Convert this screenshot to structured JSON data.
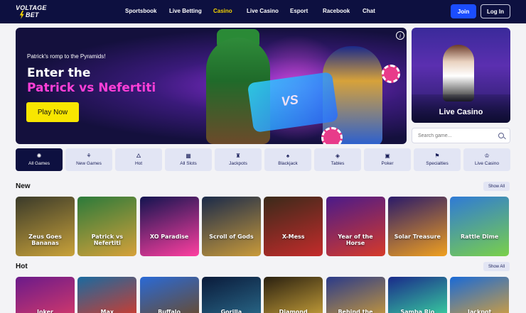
{
  "brand": {
    "logo_line1": "VOLTAGE",
    "logo_line2": "BET"
  },
  "nav": {
    "items": [
      "Sportsbook",
      "Live Betting",
      "Casino",
      "Live Casino",
      "Esport",
      "Racebook",
      "Chat"
    ],
    "active": "Casino",
    "join_label": "Join",
    "login_label": "Log In"
  },
  "hero": {
    "subtitle": "Patrick's romp to the Pyramids!",
    "headline": "Enter the",
    "game_title": "Patrick vs Nefertiti",
    "cta_label": "Play Now",
    "badge_text": "VS",
    "info_icon": "i",
    "slide_count": 3,
    "active_slide": 1
  },
  "live_casino_card": {
    "label": "Live Casino"
  },
  "search": {
    "placeholder": "Search game..."
  },
  "categories": [
    {
      "label": "All Games",
      "icon": "✺",
      "active": true
    },
    {
      "label": "New Games",
      "icon": "⚘"
    },
    {
      "label": "Hot",
      "icon": "🜂"
    },
    {
      "label": "All Slots",
      "icon": "▦"
    },
    {
      "label": "Jackpots",
      "icon": "♜"
    },
    {
      "label": "Blackjack",
      "icon": "♠"
    },
    {
      "label": "Tables",
      "icon": "◈"
    },
    {
      "label": "Poker",
      "icon": "▣"
    },
    {
      "label": "Specialties",
      "icon": "⚑"
    },
    {
      "label": "Live Casino",
      "icon": "♔"
    }
  ],
  "sections": {
    "new": {
      "title": "New",
      "show_all": "Show All",
      "games": [
        {
          "title": "Zeus Goes Bananas",
          "bg1": "#3a3a2a",
          "bg2": "#c9a23a"
        },
        {
          "title": "Patrick vs Nefertiti",
          "bg1": "#2b7a3a",
          "bg2": "#d6a13a"
        },
        {
          "title": "XO Paradise",
          "bg1": "#121450",
          "bg2": "#ff3fa0"
        },
        {
          "title": "Scroll of Gods",
          "bg1": "#1a2a4a",
          "bg2": "#c99a3a"
        },
        {
          "title": "X-Mess",
          "bg1": "#3a2a1a",
          "bg2": "#c42b2b"
        },
        {
          "title": "Year of the Horse",
          "bg1": "#4a1a8a",
          "bg2": "#d63a2a"
        },
        {
          "title": "Solar Treasure",
          "bg1": "#2a1a6a",
          "bg2": "#f0a020"
        },
        {
          "title": "Rattle Dime",
          "bg1": "#2f7ad6",
          "bg2": "#7ad04a"
        }
      ]
    },
    "hot": {
      "title": "Hot",
      "show_all": "Show All",
      "games": [
        {
          "title": "Joker",
          "bg1": "#6a1a8a",
          "bg2": "#d63a6a"
        },
        {
          "title": "Max",
          "bg1": "#1a6aa0",
          "bg2": "#d63a2a"
        },
        {
          "title": "Buffalo",
          "bg1": "#2a6ad6",
          "bg2": "#6a4a2a"
        },
        {
          "title": "Gorilla",
          "bg1": "#0a1a3a",
          "bg2": "#2a6a8a"
        },
        {
          "title": "Diamond",
          "bg1": "#2a2010",
          "bg2": "#c9a23a"
        },
        {
          "title": "Behind the",
          "bg1": "#2a3a8a",
          "bg2": "#c99a3a"
        },
        {
          "title": "Samba Rio",
          "bg1": "#1a2a8a",
          "bg2": "#3ad6a0"
        },
        {
          "title": "Jackpot",
          "bg1": "#1a6ad6",
          "bg2": "#d6a03a"
        }
      ]
    }
  }
}
